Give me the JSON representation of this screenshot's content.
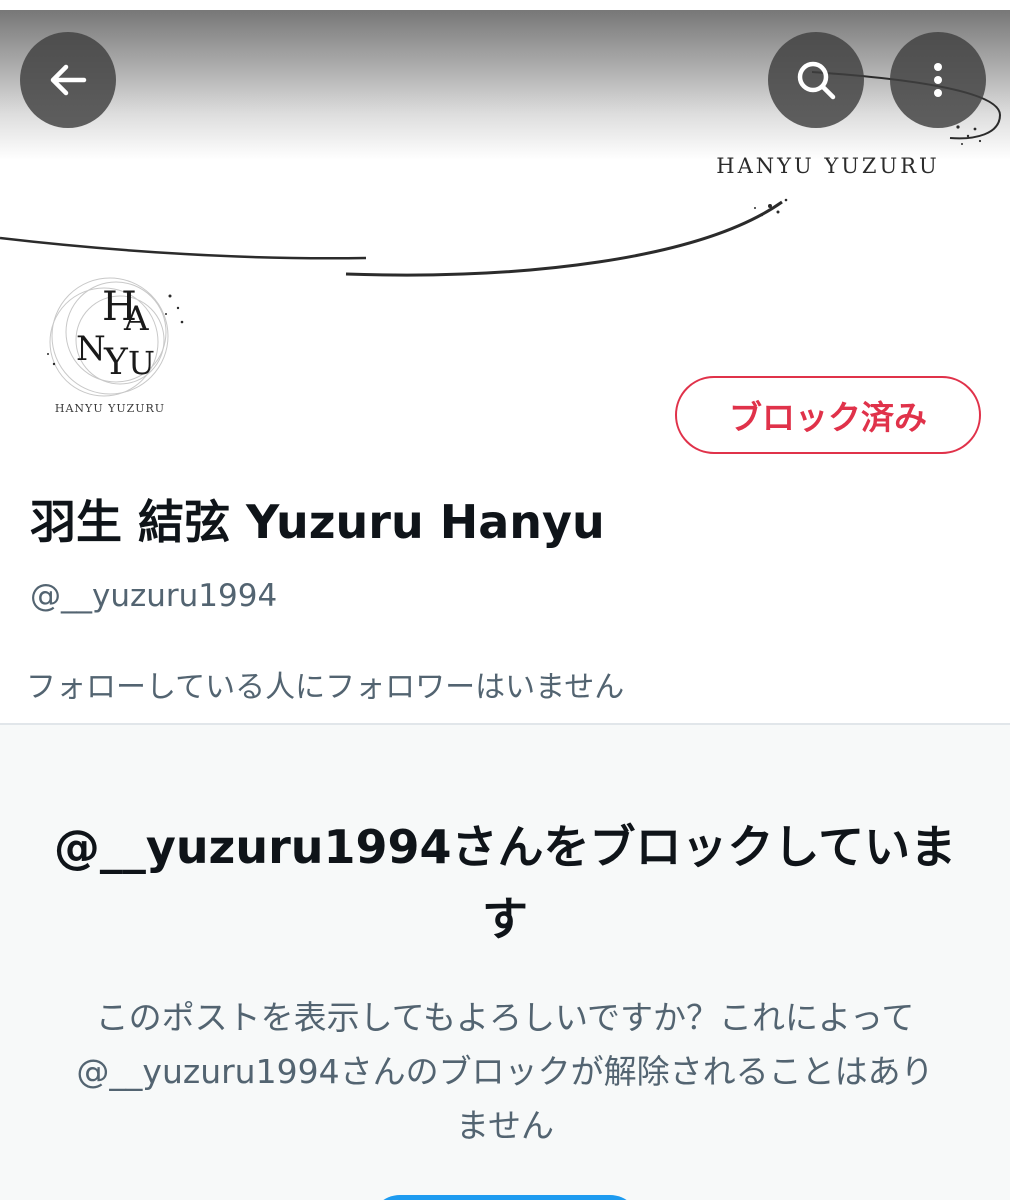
{
  "header": {
    "back_icon": "arrow-left-icon",
    "search_icon": "search-icon",
    "more_icon": "more-vertical-icon",
    "banner_logo_text": "HANYU YUZURU"
  },
  "profile": {
    "avatar_caption": "HANYU YUZURU",
    "avatar_letters": [
      "H",
      "A",
      "N",
      "Y",
      "U"
    ],
    "blocked_label": "ブロック済み",
    "display_name": "羽生 結弦 Yuzuru Hanyu",
    "handle": "@__yuzuru1994",
    "follower_note": "フォローしている人にフォロワーはいません"
  },
  "notice": {
    "title": "@__yuzuru1994さんをブロックしています",
    "body": "このポストを表示してもよろしいですか？これによって@__yuzuru1994さんのブロックが解除されることはありません"
  },
  "colors": {
    "blocked_red": "#e0324a",
    "primary_text": "#0f1419",
    "secondary_text": "#536471",
    "panel_bg": "#f7f9f9",
    "accent_blue": "#1d9bf0"
  }
}
